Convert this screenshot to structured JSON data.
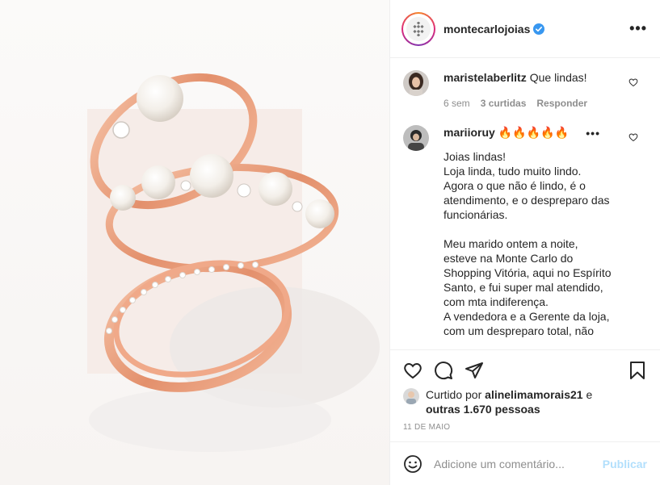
{
  "post": {
    "username": "montecarlojoias",
    "verified_icon": "verified-badge-icon",
    "more_label": "•••"
  },
  "comments": [
    {
      "username": "maristelaberlitz",
      "text": "Que lindas!",
      "time": "6 sem",
      "likes": "3 curtidas",
      "reply": "Responder"
    },
    {
      "username": "mariioruy",
      "text": "🔥🔥🔥🔥🔥",
      "more": "•••",
      "body": [
        "Joias lindas!",
        "Loja linda, tudo muito lindo.",
        "Agora o que não é lindo, é o",
        "atendimento, e o despreparo das",
        "funcionárias.",
        "",
        "Meu marido ontem a noite,",
        "esteve na Monte Carlo do",
        "Shopping Vitória, aqui no Espírito",
        "Santo, e fui super mal atendido,",
        "com mta indiferença.",
        "A vendedora e a Gerente da loja,",
        "com um despreparo total, não"
      ]
    }
  ],
  "likes": {
    "prefix": "Curtido por ",
    "user": "alinelimamorais21",
    "middle": " e",
    "others": "outras 1.670 pessoas"
  },
  "date": "11 de maio",
  "add_comment": {
    "placeholder": "Adicione um comentário...",
    "publish": "Publicar"
  },
  "colors": {
    "accent_blue": "#3897f0",
    "publish_disabled": "#b2dffc",
    "rose_gold": "#e7a184"
  }
}
